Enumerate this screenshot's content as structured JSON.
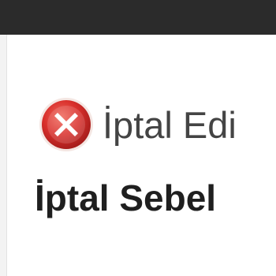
{
  "window": {
    "title_bar_color": "#2b2b2b"
  },
  "status": {
    "icon": "cancel-x-icon",
    "icon_color": "#d9302c",
    "text": "İptal Edi"
  },
  "reason": {
    "title": "İptal Sebel"
  }
}
